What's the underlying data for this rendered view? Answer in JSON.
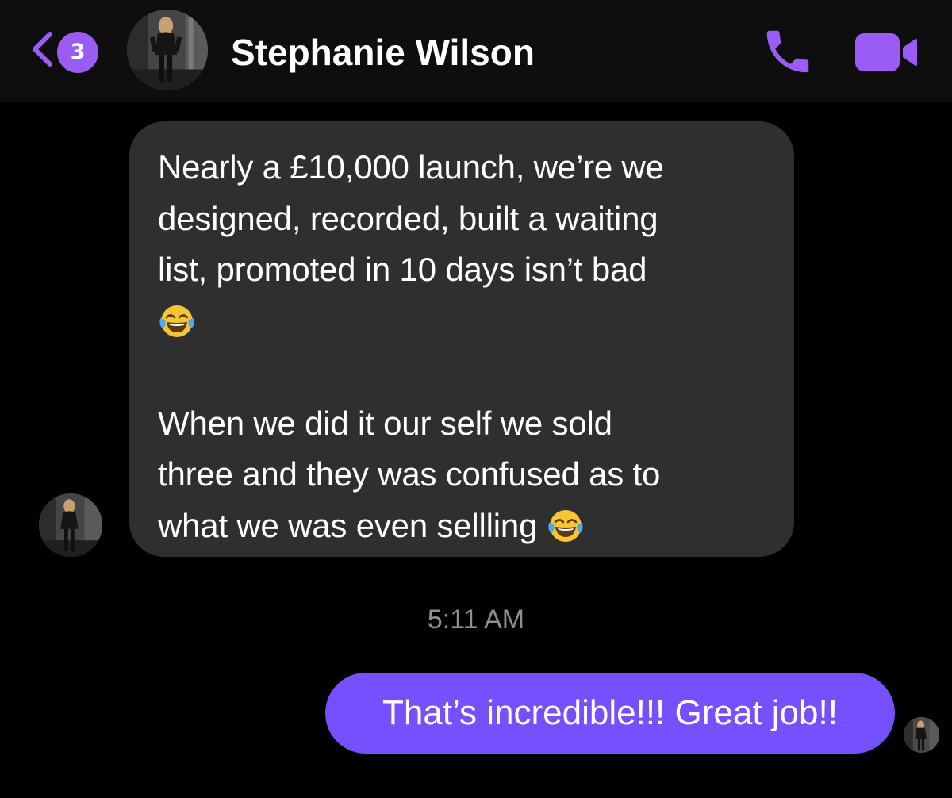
{
  "header": {
    "back_badge_count": "3",
    "contact_name": "Stephanie Wilson",
    "accent_color": "#9b5cf6",
    "icons": [
      "chevron-left-icon",
      "phone-icon",
      "video-camera-icon"
    ]
  },
  "conversation": {
    "incoming": {
      "paragraph_1": [
        "Nearly a £10,000 launch,  we’re we",
        "designed, recorded, built a waiting",
        "list, promoted in 10 days isn’t bad"
      ],
      "paragraph_2": [
        "When we did it our self we sold",
        "three and they was confused as to",
        "what we was even sellling"
      ],
      "emoji": "face-with-tears-of-joy",
      "bubble_color": "#2f2f2f"
    },
    "timestamp": "5:11 AM",
    "outgoing": {
      "text": "That’s incredible!!! Great job!!",
      "bubble_color": "#7650ff"
    }
  }
}
